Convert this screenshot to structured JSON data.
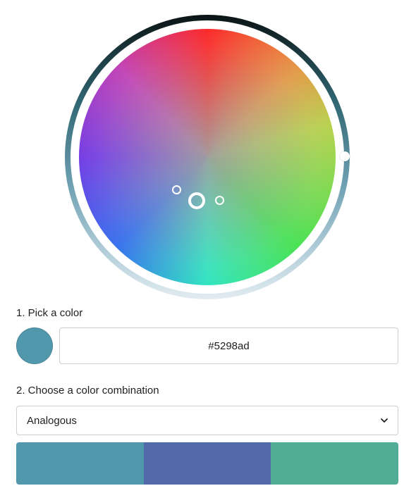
{
  "steps": {
    "pick_label": "1. Pick a color",
    "combo_label": "2. Choose a color combination"
  },
  "selected_color": {
    "hex": "#5298ad"
  },
  "combination": {
    "selected": "Analogous",
    "icon": "chevron-down-icon"
  },
  "palette": {
    "colors": [
      "#5298ad",
      "#526aa9",
      "#52ad97"
    ]
  },
  "wheel": {
    "handle_color": "#ffffff"
  }
}
